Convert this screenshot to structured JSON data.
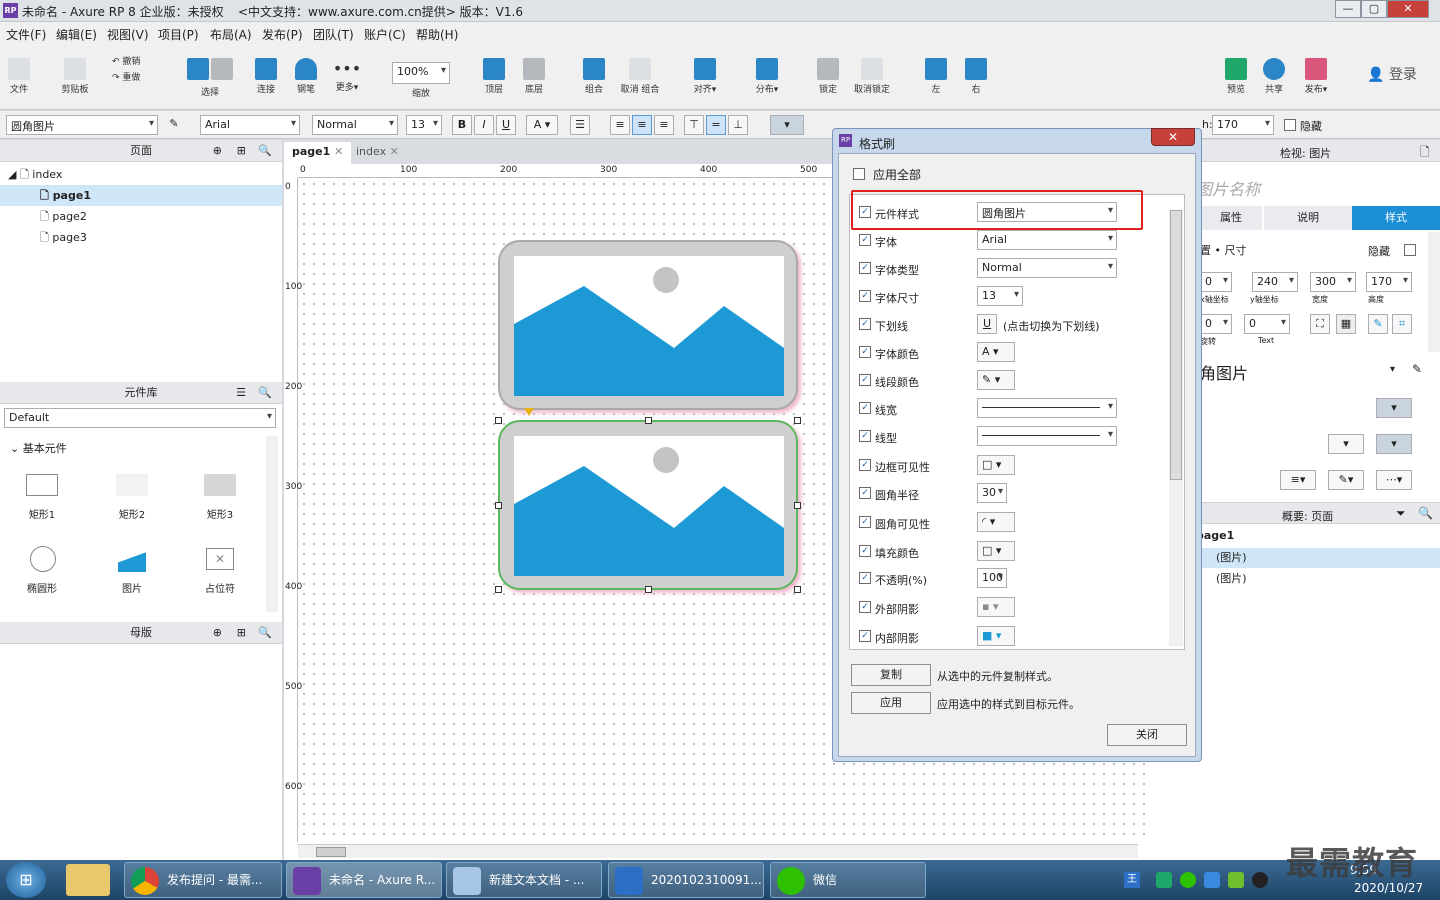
{
  "window": {
    "title": "未命名 - Axure RP 8 企业版：未授权",
    "support": "<中文支持：www.axure.com.cn提供> 版本：V1.6",
    "app_icon": "RP"
  },
  "menu": [
    "文件(F)",
    "编辑(E)",
    "视图(V)",
    "项目(P)",
    "布局(A)",
    "发布(P)",
    "团队(T)",
    "账户(C)",
    "帮助(H)"
  ],
  "toolbar": {
    "file": "文件",
    "clipboard": "剪贴板",
    "undo": "撤销",
    "redo": "重做",
    "select": "选择",
    "connect": "连接",
    "pen": "钢笔",
    "more": "更多▾",
    "zoom": "100%",
    "zoom_label": "缩放",
    "top": "顶层",
    "bottom": "底层",
    "group": "组合",
    "ungroup": "取消 组合",
    "align": "对齐▾",
    "distribute": "分布▾",
    "lock": "锁定",
    "unlock": "取消锁定",
    "left": "左",
    "right": "右",
    "preview": "预览",
    "share": "共享",
    "publish": "发布▾",
    "login": "登录"
  },
  "format": {
    "style": "圆角图片",
    "font": "Arial",
    "weight": "Normal",
    "size": "13",
    "x_label": "x:",
    "x": "200",
    "y_label": "y:",
    "y": "240",
    "w_label": "w:",
    "w": "300",
    "h_label": "h:",
    "h": "170",
    "hide": "隐藏"
  },
  "pages_panel": {
    "title": "页面",
    "items": [
      "index",
      "page1",
      "page2",
      "page3"
    ]
  },
  "library_panel": {
    "title": "元件库",
    "library": "Default",
    "section": "基本元件",
    "items": [
      "矩形1",
      "矩形2",
      "矩形3",
      "椭圆形",
      "图片",
      "占位符"
    ]
  },
  "masters_panel": {
    "title": "母版"
  },
  "tabs": [
    "page1",
    "index"
  ],
  "ruler": {
    "top": [
      "0",
      "100",
      "200",
      "300",
      "400",
      "500"
    ],
    "left": [
      "0",
      "100",
      "200",
      "300",
      "400",
      "500",
      "600"
    ]
  },
  "dialog": {
    "title": "格式刷",
    "close": "✕",
    "apply_all": "应用全部",
    "rows": [
      {
        "label": "元件样式",
        "value": "圆角图片",
        "kind": "select"
      },
      {
        "label": "字体",
        "value": "Arial",
        "kind": "select"
      },
      {
        "label": "字体类型",
        "value": "Normal",
        "kind": "select"
      },
      {
        "label": "字体尺寸",
        "value": "13",
        "kind": "small"
      },
      {
        "label": "下划线",
        "value": "(点击切换为下划线)",
        "kind": "underline"
      },
      {
        "label": "字体颜色",
        "value": "A",
        "kind": "icon"
      },
      {
        "label": "线段颜色",
        "value": "✎",
        "kind": "icon"
      },
      {
        "label": "线宽",
        "value": "",
        "kind": "line"
      },
      {
        "label": "线型",
        "value": "",
        "kind": "line"
      },
      {
        "label": "边框可见性",
        "value": "□",
        "kind": "icon"
      },
      {
        "label": "圆角半径",
        "value": "30",
        "kind": "input"
      },
      {
        "label": "圆角可见性",
        "value": "◜",
        "kind": "icon"
      },
      {
        "label": "填充颜色",
        "value": "□",
        "kind": "icon"
      },
      {
        "label": "不透明(%)",
        "value": "100",
        "kind": "input"
      },
      {
        "label": "外部阴影",
        "value": "▪",
        "kind": "icon"
      },
      {
        "label": "内部阴影",
        "value": "■",
        "kind": "icon"
      }
    ],
    "copy": "复制",
    "copy_desc": "从选中的元件复制样式。",
    "apply": "应用",
    "apply_desc": "应用选中的样式到目标元件。",
    "close_btn": "关闭",
    "highlight_color": "#e0201c"
  },
  "right_panel": {
    "title": "检视: 图片",
    "name_placeholder": "图片名称",
    "tabs": [
      "属性",
      "说明",
      "样式"
    ],
    "pos_size": "置 • 尺寸",
    "hide": "隐藏",
    "x": "0",
    "y": "240",
    "w": "300",
    "h": "170",
    "x_label": "x轴坐标",
    "y_label": "y轴坐标",
    "w_label": "宽度",
    "h_label": "高度",
    "rotate": "0",
    "rotate_label": "旋转",
    "text_rotate": "0",
    "text_label": "Text",
    "style_name": "角图片",
    "outline_title": "概要: 页面",
    "outline": [
      "page1",
      "(图片)",
      "(图片)"
    ]
  },
  "taskbar": {
    "items": [
      "发布提问 - 最需...",
      "未命名 - Axure R...",
      "新建文本文档 - ...",
      "2020102310091...",
      "微信"
    ],
    "time": "9:59",
    "date": "2020/10/27"
  },
  "watermark": "最需教育",
  "colors": {
    "accent": "#1d9ad6",
    "tab_active": "#1d8fd6"
  }
}
